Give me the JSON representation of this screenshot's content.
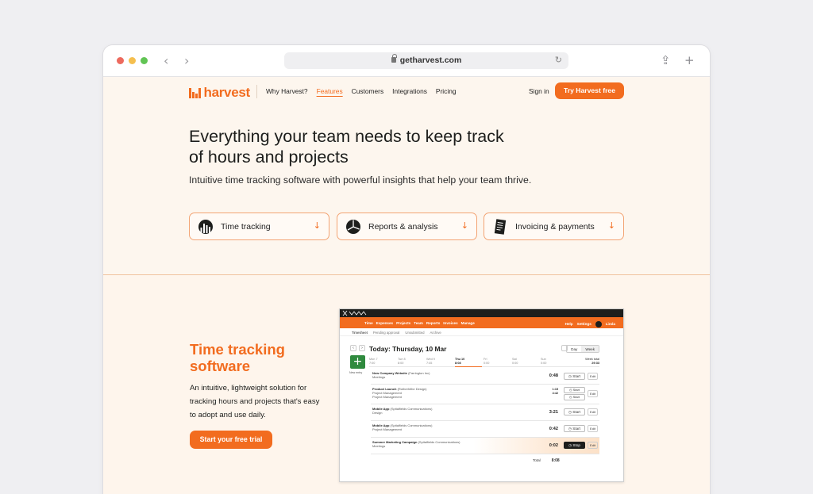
{
  "browser": {
    "url": "getharvest.com"
  },
  "nav": {
    "logo": "harvest",
    "links": [
      "Why Harvest?",
      "Features",
      "Customers",
      "Integrations",
      "Pricing"
    ],
    "active": "Features",
    "signin": "Sign in",
    "cta": "Try Harvest free"
  },
  "hero": {
    "title": "Everything your team needs to keep track of hours and projects",
    "subtitle": "Intuitive time tracking software with powerful insights that help your team thrive.",
    "cards": [
      {
        "label": "Time tracking",
        "icon": "stopwatch-icon"
      },
      {
        "label": "Reports & analysis",
        "icon": "pie-chart-icon"
      },
      {
        "label": "Invoicing & payments",
        "icon": "invoice-icon"
      }
    ]
  },
  "section": {
    "title": "Time tracking software",
    "description": "An intuitive, lightweight solution for tracking hours and projects that's easy to adopt and use daily.",
    "cta": "Start your free trial"
  },
  "app": {
    "nav": [
      "Time",
      "Expenses",
      "Projects",
      "Team",
      "Reports",
      "Invoices",
      "Manage"
    ],
    "nav_right": [
      "Help",
      "Settings",
      "Linda"
    ],
    "subtabs": [
      "Timesheet",
      "Pending approval",
      "Unsubmitted",
      "Archive"
    ],
    "today": "Today: Thursday, 10 Mar",
    "day_label": "Day",
    "week_label": "Week",
    "new_entry": "New entry",
    "days": [
      {
        "d": "Mon 7",
        "h": "7:00"
      },
      {
        "d": "Tue 8",
        "h": "8:00"
      },
      {
        "d": "Wed 9",
        "h": "7:45"
      },
      {
        "d": "Thu 10",
        "h": "8:08"
      },
      {
        "d": "Fri",
        "h": "0:00"
      },
      {
        "d": "Sat",
        "h": "0:00"
      },
      {
        "d": "Sun",
        "h": "0:00"
      }
    ],
    "week_total_label": "Week total",
    "week_total": "29:33",
    "entries": [
      {
        "project": "New Company Website",
        "client": "(Farrington Inc)",
        "task": "Meetings",
        "hours": "0:48",
        "button": "Start"
      },
      {
        "project": "Product Launch",
        "client": "(Rotherhithe Design)",
        "task": "Project Management",
        "task2": "Project Management",
        "hours": "1:15",
        "hours2": "4:42",
        "button": "Start",
        "button2": "Start"
      },
      {
        "project": "Mobile App",
        "client": "(Spitalfields Communications)",
        "task": "Design",
        "hours": "3:21",
        "button": "Start"
      },
      {
        "project": "Mobile App",
        "client": "(Spitalfields Communications)",
        "task": "Project Management",
        "hours": "0:42",
        "button": "Start"
      },
      {
        "project": "Summer Marketing Campaign",
        "client": "(Spitalfields Communications)",
        "task": "Meetings",
        "hours": "0:02",
        "button": "Stop"
      }
    ],
    "edit_label": "Edit",
    "total_label": "Total",
    "total": "8:08"
  }
}
